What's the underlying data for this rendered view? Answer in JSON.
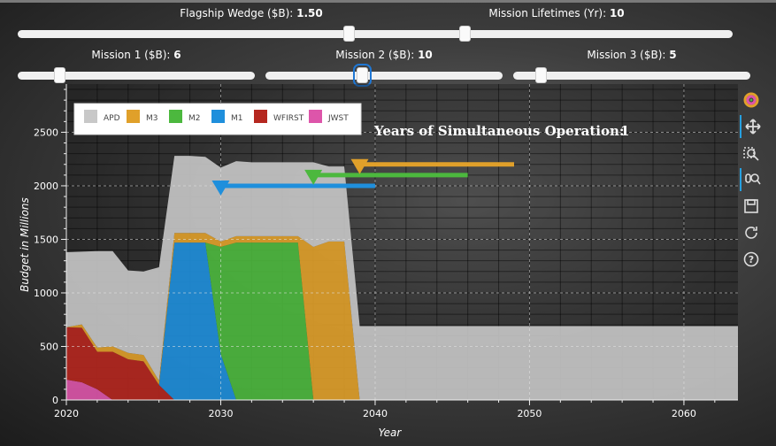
{
  "sliders": [
    {
      "id": "flagship",
      "label": "Flagship Wedge ($B): ",
      "value": "1.50",
      "frac": 0.71
    },
    {
      "id": "lifetimes",
      "label": "Mission Lifetimes (Yr): ",
      "value": "10",
      "frac": 0.24
    },
    {
      "id": "m1",
      "label": "Mission 1 ($B): ",
      "value": "6",
      "frac": 0.18
    },
    {
      "id": "m2",
      "label": "Mission 2 ($B): ",
      "value": "10",
      "frac": 0.41
    },
    {
      "id": "m3",
      "label": "Mission 3 ($B): ",
      "value": "5",
      "frac": 0.12
    }
  ],
  "chart_data": {
    "type": "area",
    "stacked": true,
    "xlabel": "Year",
    "ylabel": "Budget in Millions",
    "xlim": [
      2020,
      2063.5
    ],
    "ylim": [
      0,
      2950
    ],
    "xticks": [
      2020,
      2030,
      2040,
      2050,
      2060
    ],
    "yticks": [
      0,
      500,
      1000,
      1500,
      2000,
      2500
    ],
    "grid": true,
    "legend_position": "top-left",
    "annotation": {
      "label": "Years of Simultaneous Operation:",
      "value": "1"
    },
    "x": [
      2020,
      2021,
      2022,
      2023,
      2024,
      2025,
      2026,
      2027,
      2028,
      2029,
      2030,
      2031,
      2032,
      2033,
      2034,
      2035,
      2036,
      2037,
      2038,
      2039,
      2040,
      2063.5
    ],
    "series": [
      {
        "name": "JWST",
        "color": "#dd55aa",
        "values": [
          190,
          165,
          100,
          0,
          0,
          0,
          0,
          0,
          0,
          0,
          0,
          0,
          0,
          0,
          0,
          0,
          0,
          0,
          0,
          0,
          0,
          0
        ]
      },
      {
        "name": "WFIRST",
        "color": "#b5271f",
        "values": [
          490,
          510,
          350,
          450,
          380,
          360,
          140,
          0,
          0,
          0,
          0,
          0,
          0,
          0,
          0,
          0,
          0,
          0,
          0,
          0,
          0,
          0
        ]
      },
      {
        "name": "M1",
        "color": "#1f8fdc",
        "values": [
          0,
          0,
          0,
          0,
          0,
          0,
          0,
          1470,
          1470,
          1470,
          430,
          0,
          0,
          0,
          0,
          0,
          0,
          0,
          0,
          0,
          0,
          0
        ]
      },
      {
        "name": "M2",
        "color": "#4cb83e",
        "values": [
          0,
          0,
          0,
          0,
          0,
          0,
          0,
          0,
          0,
          0,
          1000,
          1470,
          1470,
          1470,
          1470,
          1470,
          0,
          0,
          0,
          0,
          0,
          0
        ]
      },
      {
        "name": "M3",
        "color": "#e0a02a",
        "values": [
          0,
          30,
          40,
          50,
          60,
          60,
          40,
          90,
          90,
          90,
          50,
          60,
          60,
          60,
          60,
          60,
          1430,
          1480,
          1480,
          0,
          0,
          0
        ]
      },
      {
        "name": "APD",
        "color": "#c8c8c8",
        "values": [
          700,
          680,
          900,
          890,
          770,
          780,
          1060,
          720,
          720,
          710,
          690,
          700,
          690,
          690,
          690,
          690,
          790,
          700,
          700,
          690,
          690,
          690
        ]
      }
    ],
    "markers": [
      {
        "series": "M1",
        "color": "#1f8fdc",
        "start": 2030,
        "end": 2040,
        "y": 2000
      },
      {
        "series": "M2",
        "color": "#4cb83e",
        "start": 2036,
        "end": 2046,
        "y": 2100
      },
      {
        "series": "M3",
        "color": "#e0a02a",
        "start": 2039,
        "end": 2049,
        "y": 2200
      }
    ]
  },
  "toolbar": [
    {
      "name": "bokeh-logo-icon"
    },
    {
      "name": "pan-icon"
    },
    {
      "name": "box-zoom-icon"
    },
    {
      "name": "wheel-zoom-icon"
    },
    {
      "name": "save-icon"
    },
    {
      "name": "reset-icon"
    },
    {
      "name": "help-icon"
    }
  ]
}
